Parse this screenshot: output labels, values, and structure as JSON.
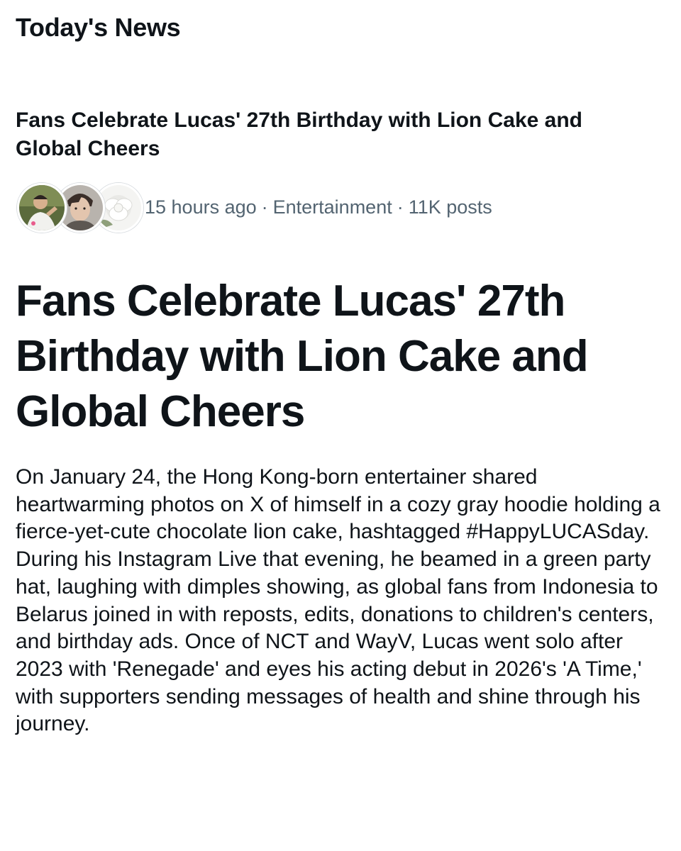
{
  "header": {
    "title": "Today's News"
  },
  "trend": {
    "headline": "Fans Celebrate Lucas' 27th Birthday with Lion Cake and Global Cheers",
    "avatar_icons": [
      "avatar-photo-man",
      "avatar-photo-portrait",
      "avatar-photo-flower"
    ],
    "time_ago": "15 hours ago",
    "separator": "·",
    "category": "Entertainment",
    "post_count": "11K posts"
  },
  "article": {
    "title": "Fans Celebrate Lucas' 27th Birthday with Lion Cake and Global Cheers",
    "body": "On January 24, the Hong Kong-born entertainer shared heartwarming photos on X of himself in a cozy gray hoodie holding a fierce-yet-cute chocolate lion cake, hashtagged #HappyLUCASday. During his Instagram Live that evening, he beamed in a green party hat, laughing with dimples showing, as global fans from Indonesia to Belarus joined in with reposts, edits, donations to children's centers, and birthday ads. Once of NCT and WayV, Lucas went solo after 2023 with 'Renegade' and eyes his acting debut in 2026's 'A Time,' with supporters sending messages of health and shine through his journey."
  },
  "colors": {
    "text_primary": "#0f1419",
    "text_secondary": "#536471",
    "background": "#ffffff"
  }
}
